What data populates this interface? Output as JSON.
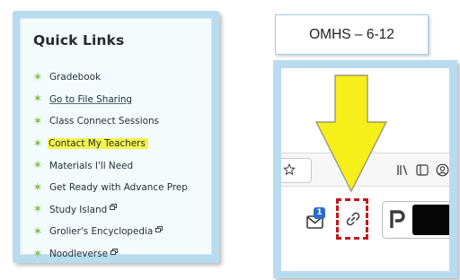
{
  "quick_links": {
    "title": "Quick Links",
    "items": [
      {
        "label": "Gradebook",
        "style": "normal",
        "external": false
      },
      {
        "label": "Go to File Sharing",
        "style": "underline",
        "external": false
      },
      {
        "label": "Class Connect Sessions",
        "style": "normal",
        "external": false
      },
      {
        "label": "Contact My Teachers",
        "style": "highlight",
        "external": false
      },
      {
        "label": "Materials I'll Need",
        "style": "normal",
        "external": false
      },
      {
        "label": "Get Ready with Advance Prep",
        "style": "normal",
        "external": false
      },
      {
        "label": "Study Island",
        "style": "normal",
        "external": true
      },
      {
        "label": "Grolier's Encyclopedia",
        "style": "normal",
        "external": true
      },
      {
        "label": "Noodleverse",
        "style": "normal",
        "external": true
      }
    ],
    "colors": {
      "star": "#7bc147",
      "highlight": "#f6f34b",
      "panel_border": "#b9dbef"
    }
  },
  "label_box": {
    "text": "OMHS – 6-12"
  },
  "browser_crop": {
    "notification_badge_count": "1",
    "icons": [
      "star-icon",
      "library-icon",
      "sidebar-icon",
      "account-icon",
      "message-icon",
      "link-icon",
      "profile-icon"
    ],
    "highlighted_icon": "link-icon",
    "colors": {
      "arrow_fill": "#f6ef1a",
      "arrow_stroke": "#9a9a7a",
      "dashed_box": "#c2161b"
    }
  }
}
